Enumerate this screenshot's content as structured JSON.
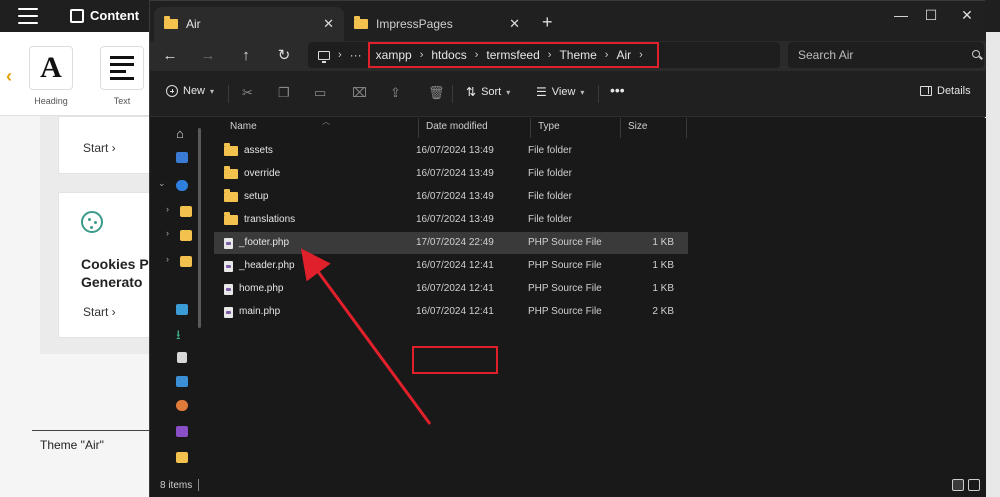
{
  "background_app": {
    "header_title": "Content",
    "widgets": [
      {
        "label": "Heading",
        "icon": "heading-a-icon"
      },
      {
        "label": "Text",
        "icon": "text-lines-icon"
      }
    ],
    "card1_start": "Start",
    "card2_title_line1": "Cookies P",
    "card2_title_line2": "Generato",
    "card2_start": "Start",
    "theme_label": "Theme \"Air\""
  },
  "explorer": {
    "tabs": [
      {
        "label": "Air",
        "active": true
      },
      {
        "label": "ImpressPages",
        "active": false
      }
    ],
    "breadcrumb": [
      "xampp",
      "htdocs",
      "termsfeed",
      "Theme",
      "Air"
    ],
    "search_placeholder": "Search Air",
    "commands": {
      "new": "New",
      "sort": "Sort",
      "view": "View",
      "details": "Details"
    },
    "columns": {
      "name": "Name",
      "date": "Date modified",
      "type": "Type",
      "size": "Size"
    },
    "files": [
      {
        "name": "assets",
        "date": "16/07/2024 13:49",
        "type": "File folder",
        "size": "",
        "kind": "folder"
      },
      {
        "name": "override",
        "date": "16/07/2024 13:49",
        "type": "File folder",
        "size": "",
        "kind": "folder"
      },
      {
        "name": "setup",
        "date": "16/07/2024 13:49",
        "type": "File folder",
        "size": "",
        "kind": "folder"
      },
      {
        "name": "translations",
        "date": "16/07/2024 13:49",
        "type": "File folder",
        "size": "",
        "kind": "folder"
      },
      {
        "name": "_footer.php",
        "date": "17/07/2024 22:49",
        "type": "PHP Source File",
        "size": "1 KB",
        "kind": "file",
        "selected": true
      },
      {
        "name": "_header.php",
        "date": "16/07/2024 12:41",
        "type": "PHP Source File",
        "size": "1 KB",
        "kind": "file"
      },
      {
        "name": "home.php",
        "date": "16/07/2024 12:41",
        "type": "PHP Source File",
        "size": "1 KB",
        "kind": "file"
      },
      {
        "name": "main.php",
        "date": "16/07/2024 12:41",
        "type": "PHP Source File",
        "size": "2 KB",
        "kind": "file"
      }
    ],
    "status": "8 items",
    "colors": {
      "highlight_red": "#e0202a",
      "folder_yellow": "#f2c14e",
      "window_bg": "#191919"
    }
  }
}
